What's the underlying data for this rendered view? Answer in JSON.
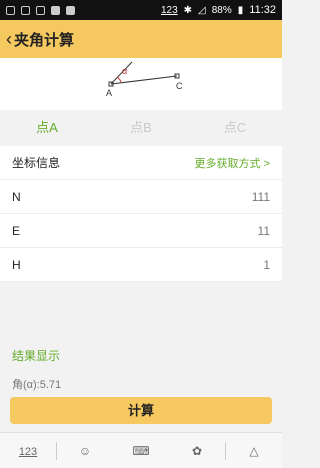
{
  "status_bar": {
    "num_label": "123",
    "battery": "88%",
    "time": "11:32"
  },
  "app_bar": {
    "back_icon": "chevron-left-icon",
    "title": "夹角计算"
  },
  "diagram": {
    "point_a": "A",
    "point_c": "C",
    "angle_symbol": "α"
  },
  "tabs": [
    {
      "label": "点A",
      "active": true
    },
    {
      "label": "点B",
      "active": false
    },
    {
      "label": "点C",
      "active": false
    }
  ],
  "coords": {
    "header_label": "坐标信息",
    "more_link": "更多获取方式 >",
    "rows": [
      {
        "label": "N",
        "value": "111"
      },
      {
        "label": "E",
        "value": "11"
      },
      {
        "label": "H",
        "value": "1"
      }
    ]
  },
  "result": {
    "title": "结果显示",
    "value": "角(α):5.71"
  },
  "calculate_button": "计算",
  "nav_bar": {
    "num_key": "123",
    "icons": [
      "emoji-icon",
      "keyboard-icon",
      "settings-icon",
      "collapse-icon"
    ]
  },
  "colors": {
    "accent": "#f5c860",
    "active_green": "#63ac2a"
  }
}
